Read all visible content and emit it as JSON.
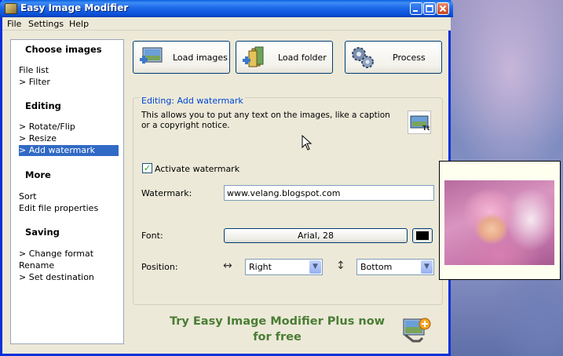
{
  "window": {
    "title": "Easy Image Modifier"
  },
  "menu": [
    "File",
    "Settings",
    "Help"
  ],
  "sidebar": {
    "sections": [
      {
        "header": "Choose images",
        "items": [
          "File list",
          "> Filter"
        ]
      },
      {
        "header": "Editing",
        "items": [
          "> Rotate/Flip",
          "> Resize",
          "> Add watermark"
        ]
      },
      {
        "header": "More",
        "items": [
          "Sort",
          "Edit file properties"
        ]
      },
      {
        "header": "Saving",
        "items": [
          "> Change format",
          "Rename",
          "> Set destination"
        ]
      }
    ],
    "selected": "> Add watermark"
  },
  "toolbar": {
    "load_images": "Load images",
    "load_folder": "Load folder",
    "process": "Process"
  },
  "editing": {
    "legend": "Editing: Add watermark",
    "description": "This allows you to put any text on the images, like a caption or a copyright notice.",
    "activate_label": "Activate watermark",
    "activate_checked": true,
    "watermark_label": "Watermark:",
    "watermark_value": "www.velang.blogspot.com",
    "font_label": "Font:",
    "font_value": "Arial, 28",
    "font_color": "#000000",
    "position_label": "Position:",
    "horizontal": "Right",
    "vertical": "Bottom"
  },
  "promo": {
    "text": "Try Easy Image Modifier Plus now for free"
  },
  "icons": {
    "minimize": "minimize-icon",
    "maximize": "maximize-icon",
    "close": "close-icon",
    "horizontal_arrows": "↔",
    "vertical_arrows": "↕",
    "dropdown": "▼",
    "check": "✓"
  },
  "colors": {
    "accent": "#316ac5",
    "titlebar": "#0a5fe0",
    "promo": "#4a7d34",
    "legend": "#0046d5"
  }
}
